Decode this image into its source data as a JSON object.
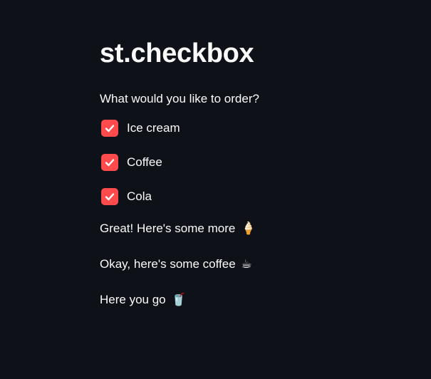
{
  "title": "st.checkbox",
  "question": "What would you like to order?",
  "checkboxes": [
    {
      "label": "Ice cream",
      "checked": true
    },
    {
      "label": "Coffee",
      "checked": true
    },
    {
      "label": "Cola",
      "checked": true
    }
  ],
  "messages": [
    {
      "text": "Great! Here's some more",
      "emoji": "🍦"
    },
    {
      "text": "Okay, here's some coffee",
      "emoji": "☕"
    },
    {
      "text": "Here you go",
      "emoji": "🥤"
    }
  ],
  "colors": {
    "background": "#0e1117",
    "text": "#fafafa",
    "checkbox_accent": "#ff4b4b"
  }
}
